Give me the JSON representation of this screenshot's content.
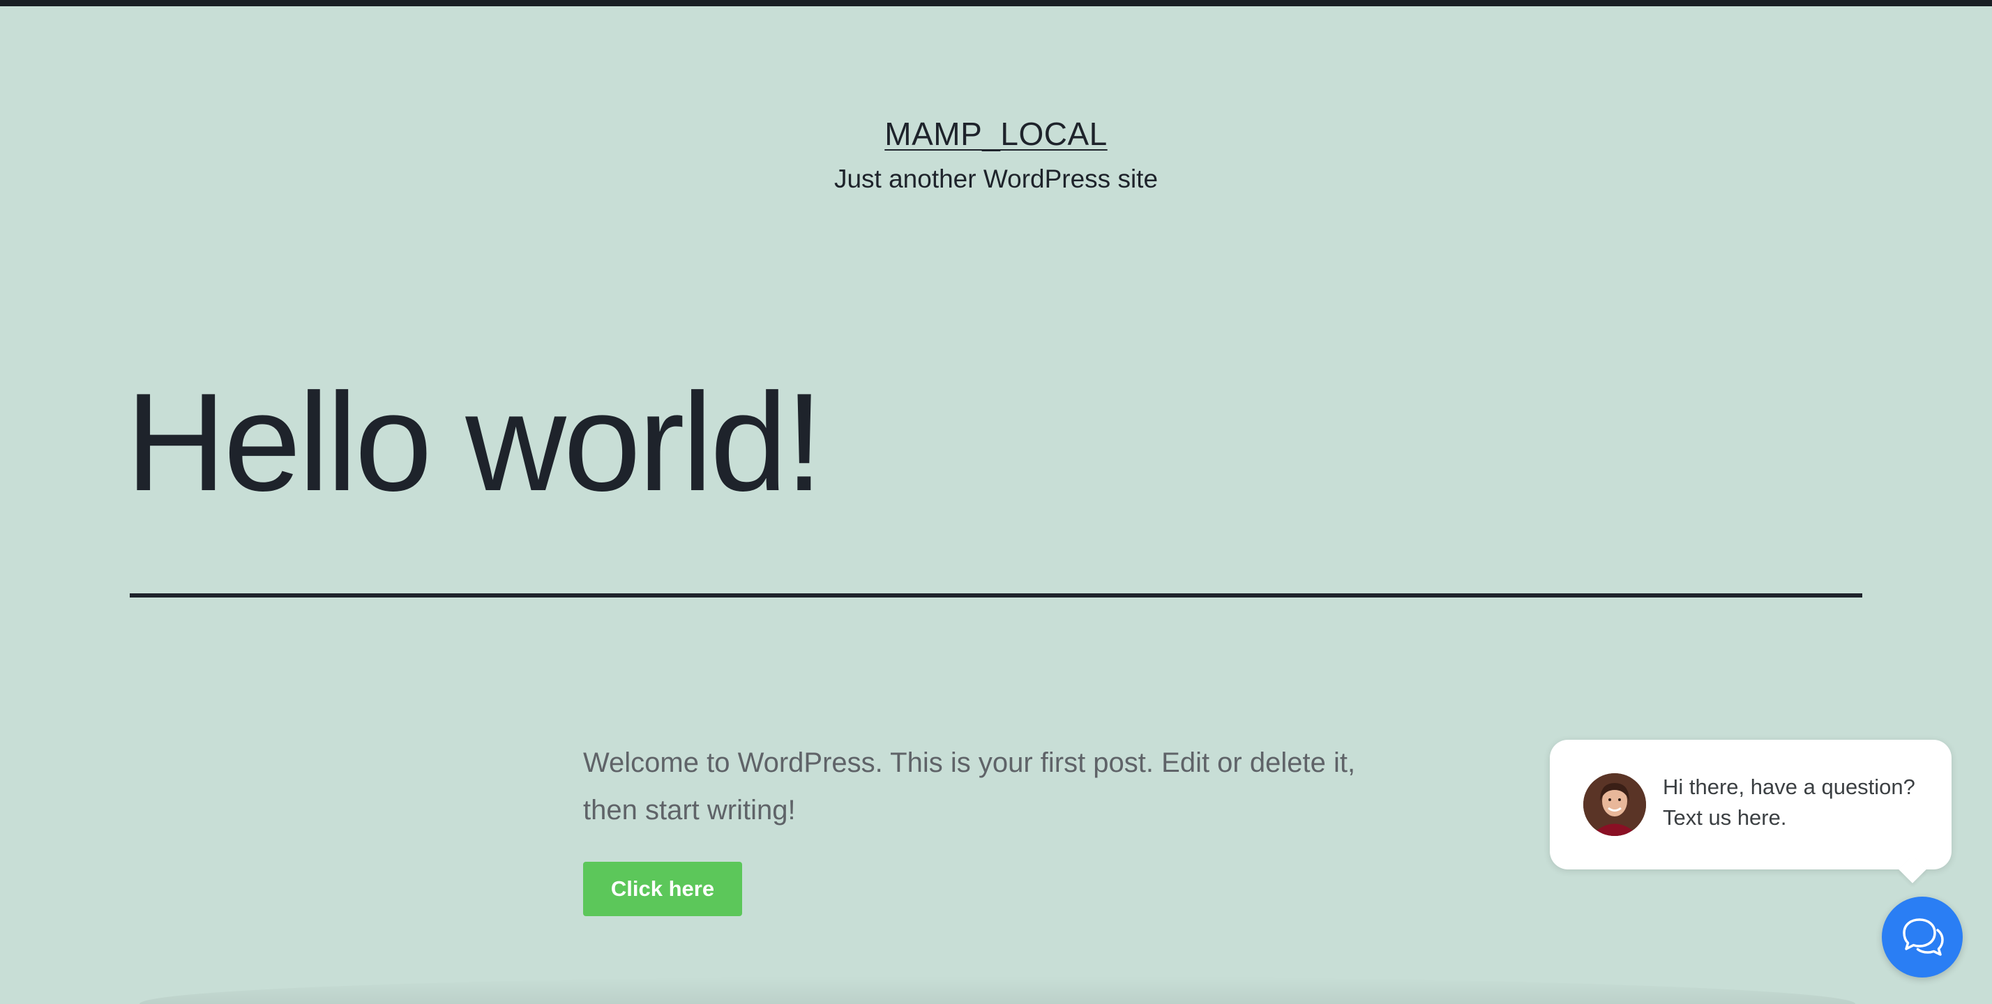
{
  "header": {
    "site_title": "MAMP_LOCAL",
    "tagline": "Just another WordPress site"
  },
  "post": {
    "title": "Hello world!",
    "content": "Welcome to WordPress. This is your first post. Edit or delete it, then start writing!",
    "button_label": "Click here"
  },
  "chat_widget": {
    "greeting": "Hi there, have a question? Text us here.",
    "avatar_icon": "agent-avatar",
    "launcher_icon": "chat-bubbles-icon",
    "launcher_color": "#2a7ef4"
  },
  "colors": {
    "background": "#c8ded6",
    "text": "#1e232b",
    "button": "#5cc75a"
  }
}
